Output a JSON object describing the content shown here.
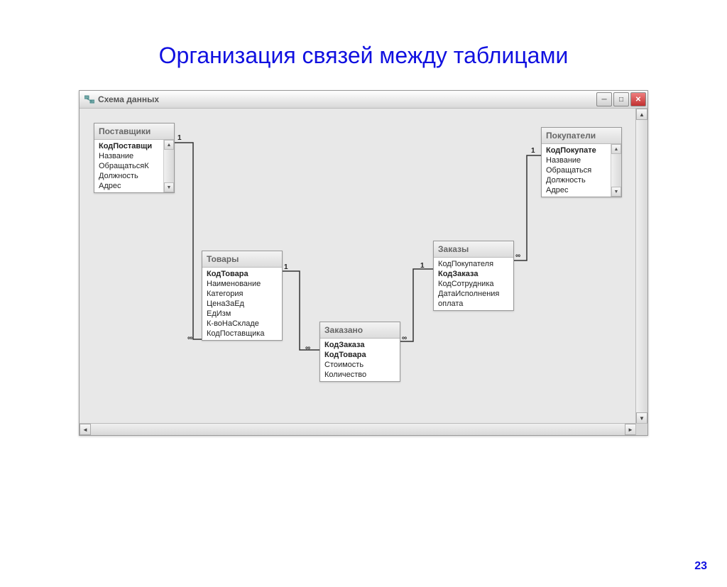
{
  "slide": {
    "title": "Организация связей между таблицами",
    "page_number": "23"
  },
  "window": {
    "title": "Схема данных"
  },
  "tables": {
    "suppliers": {
      "name": "Поставщики",
      "fields": [
        "КодПоставщи",
        "Название",
        "ОбращатьсяК",
        "Должность",
        "Адрес"
      ]
    },
    "goods": {
      "name": "Товары",
      "fields": [
        "КодТовара",
        "Наименование",
        "Категория",
        "ЦенаЗаЕд",
        "ЕдИзм",
        "К-воНаСкладе",
        "КодПоставщика"
      ]
    },
    "ordered": {
      "name": "Заказано",
      "fields": [
        "КодЗаказа",
        "КодТовара",
        "Стоимость",
        "Количество"
      ]
    },
    "orders": {
      "name": "Заказы",
      "fields": [
        "КодПокупателя",
        "КодЗаказа",
        "КодСотрудника",
        "ДатаИсполнения",
        "оплата"
      ]
    },
    "buyers": {
      "name": "Покупатели",
      "fields": [
        "КодПокупате",
        "Название",
        "Обращаться",
        "Должность",
        "Адрес"
      ]
    }
  },
  "relations": {
    "one": "1",
    "many": "∞"
  }
}
